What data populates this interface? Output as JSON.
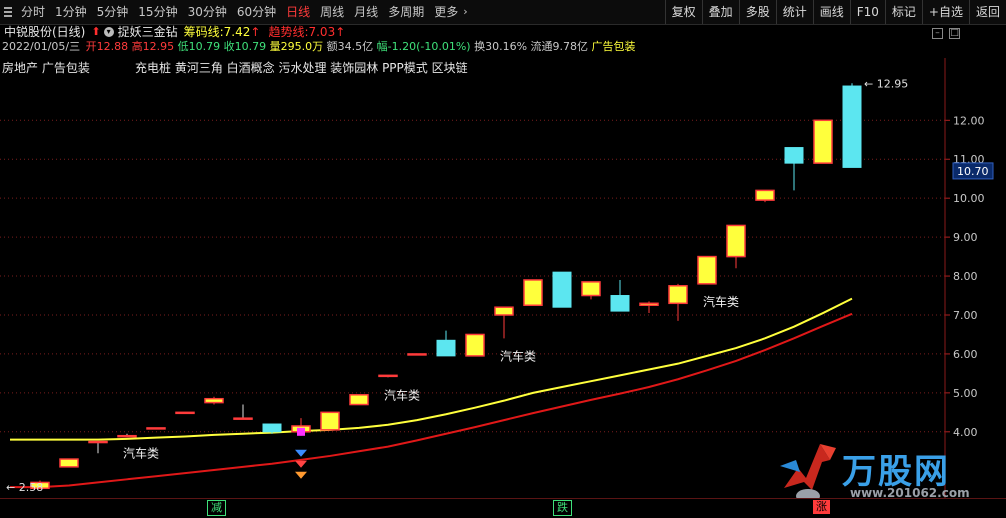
{
  "toolbar": {
    "periods": [
      "分时",
      "1分钟",
      "5分钟",
      "15分钟",
      "30分钟",
      "60分钟",
      "日线",
      "周线",
      "月线",
      "多周期",
      "更多"
    ],
    "active_period": "日线",
    "more_arrow": "›",
    "tools": [
      "复权",
      "叠加",
      "多股",
      "统计",
      "画线",
      "F10",
      "标记",
      "+自选",
      "返回"
    ]
  },
  "header": {
    "stock": "中锐股份(日线)",
    "indicator": "捉妖三金钻",
    "chip_label": "筹码线:",
    "chip_value": "7.42",
    "trend_label": "趋势线:",
    "trend_value": "7.03",
    "up_arrow": "↑"
  },
  "quote": {
    "date": "2022/01/05/三",
    "open_label": "开",
    "open": "12.88",
    "high_label": "高",
    "high": "12.95",
    "low_label": "低",
    "low": "10.79",
    "close_label": "收",
    "close": "10.79",
    "volume_label": "量",
    "volume": "295.0万",
    "amount_label": "额",
    "amount": "34.5亿",
    "change_label": "幅",
    "change": "-1.20(-10.01%)",
    "turnover_label": "换",
    "turnover": "30.16%",
    "float_label": "流通",
    "float": "9.78亿",
    "concept": "广告包装"
  },
  "tags": {
    "industry": "房地产 广告包装",
    "concepts": "充电桩 黄河三角 白酒概念 污水处理 装饰园林 PPP模式 区块链"
  },
  "watermark": {
    "text": "万股网",
    "url": "www.201062.com"
  },
  "bottom_tags": [
    "减",
    "跌",
    "涨"
  ],
  "colors": {
    "up": "#ff3b3b",
    "down": "#5ce6f0",
    "yellow": "#ffff3c",
    "trend": "#e01818",
    "grid": "#7a1e1e",
    "bg": "#000000"
  },
  "chart_data": {
    "type": "candlestick",
    "y_ticks": [
      4.0,
      5.0,
      6.0,
      7.0,
      8.0,
      9.0,
      10.0,
      11.0,
      12.0
    ],
    "ylim": [
      2.3,
      13.6
    ],
    "last_price_label": "10.70",
    "high_marker": "12.95",
    "low_marker": "2.58",
    "candles": [
      {
        "o": 2.55,
        "h": 2.75,
        "l": 2.55,
        "c": 2.7,
        "x": 40
      },
      {
        "o": 3.1,
        "h": 3.3,
        "l": 3.1,
        "c": 3.3,
        "x": 69
      },
      {
        "o": 3.75,
        "h": 3.75,
        "l": 3.45,
        "c": 3.75,
        "x": 98
      },
      {
        "o": 3.9,
        "h": 3.95,
        "l": 3.9,
        "c": 3.9,
        "x": 127
      },
      {
        "o": 4.1,
        "h": 4.1,
        "l": 4.1,
        "c": 4.1,
        "x": 156
      },
      {
        "o": 4.5,
        "h": 4.5,
        "l": 4.5,
        "c": 4.5,
        "x": 185
      },
      {
        "o": 4.75,
        "h": 4.9,
        "l": 4.7,
        "c": 4.85,
        "x": 214
      },
      {
        "o": 4.35,
        "h": 4.7,
        "l": 4.35,
        "c": 4.35,
        "x": 243
      },
      {
        "o": 4.2,
        "h": 4.2,
        "l": 3.95,
        "c": 4.0,
        "x": 272
      },
      {
        "o": 4.0,
        "h": 4.35,
        "l": 3.9,
        "c": 4.15,
        "x": 301
      },
      {
        "o": 4.05,
        "h": 4.5,
        "l": 4.05,
        "c": 4.5,
        "x": 330
      },
      {
        "o": 4.7,
        "h": 4.95,
        "l": 4.7,
        "c": 4.95,
        "x": 359
      },
      {
        "o": 5.45,
        "h": 5.45,
        "l": 5.4,
        "c": 5.45,
        "x": 388
      },
      {
        "o": 6.0,
        "h": 6.0,
        "l": 6.0,
        "c": 6.0,
        "x": 417
      },
      {
        "o": 6.35,
        "h": 6.6,
        "l": 5.95,
        "c": 5.95,
        "x": 446
      },
      {
        "o": 5.95,
        "h": 6.5,
        "l": 5.95,
        "c": 6.5,
        "x": 475
      },
      {
        "o": 7.0,
        "h": 7.2,
        "l": 6.4,
        "c": 7.2,
        "x": 504
      },
      {
        "o": 7.25,
        "h": 7.9,
        "l": 7.25,
        "c": 7.9,
        "x": 533
      },
      {
        "o": 8.1,
        "h": 8.1,
        "l": 7.2,
        "c": 7.2,
        "x": 562
      },
      {
        "o": 7.5,
        "h": 7.85,
        "l": 7.4,
        "c": 7.85,
        "x": 591
      },
      {
        "o": 7.5,
        "h": 7.9,
        "l": 7.1,
        "c": 7.1,
        "x": 620
      },
      {
        "o": 7.25,
        "h": 7.35,
        "l": 7.05,
        "c": 7.3,
        "x": 649
      },
      {
        "o": 7.3,
        "h": 7.8,
        "l": 6.85,
        "c": 7.75,
        "x": 678
      },
      {
        "o": 7.8,
        "h": 8.5,
        "l": 7.8,
        "c": 8.5,
        "x": 707
      },
      {
        "o": 8.5,
        "h": 9.3,
        "l": 8.2,
        "c": 9.3,
        "x": 736
      },
      {
        "o": 9.95,
        "h": 10.2,
        "l": 9.9,
        "c": 10.2,
        "x": 765
      },
      {
        "o": 11.3,
        "h": 11.3,
        "l": 10.2,
        "c": 10.9,
        "x": 794
      },
      {
        "o": 10.9,
        "h": 12.0,
        "l": 10.9,
        "c": 12.0,
        "x": 823
      },
      {
        "o": 12.88,
        "h": 12.95,
        "l": 10.79,
        "c": 10.79,
        "x": 852
      }
    ],
    "chip_line": [
      3.8,
      3.8,
      3.8,
      3.82,
      3.85,
      3.88,
      3.92,
      3.95,
      3.98,
      4.02,
      4.05,
      4.1,
      4.18,
      4.3,
      4.45,
      4.62,
      4.8,
      5.0,
      5.15,
      5.3,
      5.45,
      5.6,
      5.75,
      5.95,
      6.15,
      6.4,
      6.7,
      7.05,
      7.42
    ],
    "trend_line": [
      2.58,
      2.62,
      2.7,
      2.78,
      2.86,
      2.94,
      3.02,
      3.1,
      3.18,
      3.28,
      3.38,
      3.5,
      3.62,
      3.78,
      3.95,
      4.12,
      4.3,
      4.48,
      4.65,
      4.82,
      4.98,
      5.15,
      5.35,
      5.58,
      5.82,
      6.1,
      6.4,
      6.72,
      7.03
    ],
    "labels": [
      {
        "text": "汽车类",
        "i": 3
      },
      {
        "text": "汽车类",
        "i": 12
      },
      {
        "text": "汽车类",
        "i": 16
      },
      {
        "text": "汽车类",
        "i": 23
      }
    ]
  }
}
